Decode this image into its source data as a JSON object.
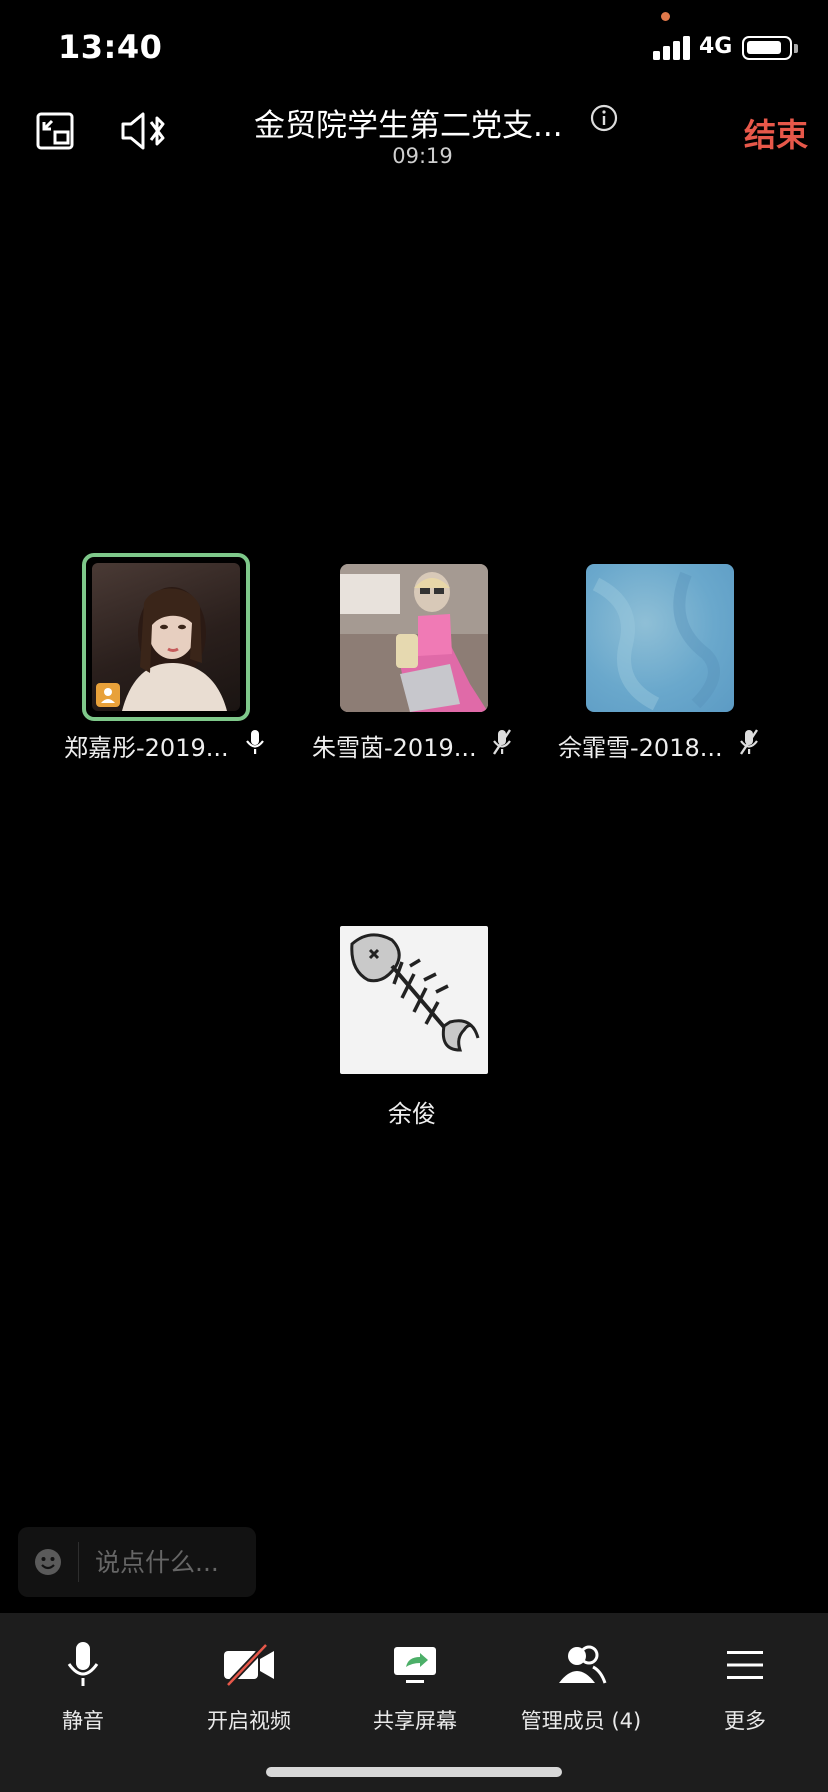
{
  "status_bar": {
    "time": "13:40",
    "network": "4G"
  },
  "header": {
    "title": "金贸院学生第二党支...",
    "timer": "09:19",
    "end_label": "结束",
    "icons": [
      "pip-icon",
      "speaker-bluetooth-icon",
      "info-icon"
    ]
  },
  "participants": [
    {
      "name": "郑嘉彤-2019...",
      "mic": "on",
      "speaking": true
    },
    {
      "name": "朱雪茵-2019...",
      "mic": "muted",
      "speaking": false
    },
    {
      "name": "佘霏雪-2018...",
      "mic": "muted",
      "speaking": false
    },
    {
      "name": "余俊",
      "mic": "none",
      "speaking": false
    }
  ],
  "chat": {
    "placeholder": "说点什么..."
  },
  "toolbar": {
    "mute": "静音",
    "video": "开启视频",
    "share": "共享屏幕",
    "members": "管理成员 (4)",
    "more": "更多"
  },
  "colors": {
    "accent_end": "#e7584a",
    "speaking_border": "#7ec88a",
    "toolbar_bg": "#1d1d1d"
  }
}
